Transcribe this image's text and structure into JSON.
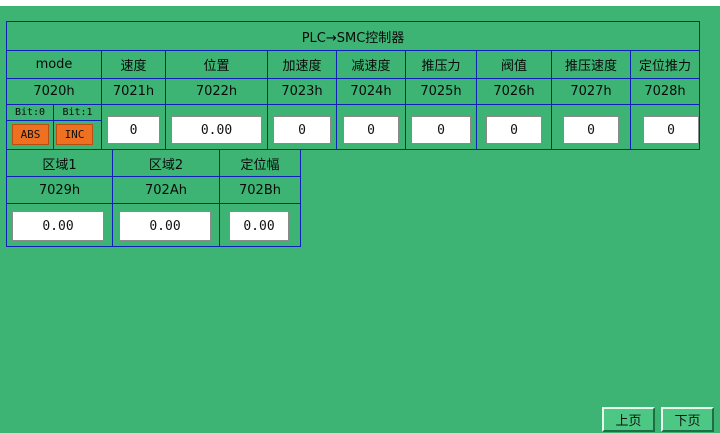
{
  "title": "PLC→SMC控制器",
  "row1": {
    "labels": [
      "mode",
      "速度",
      "位置",
      "加速度",
      "减速度",
      "推压力",
      "阀值",
      "推压速度",
      "定位推力"
    ],
    "addresses": [
      "7020h",
      "7021h",
      "7022h",
      "7023h",
      "7024h",
      "7025h",
      "7026h",
      "7027h",
      "7028h"
    ],
    "values": [
      "0",
      "0.00",
      "0",
      "0",
      "0",
      "0",
      "0",
      "0"
    ]
  },
  "mode": {
    "bit0_label": "Bit:0",
    "bit1_label": "Bit:1",
    "abs_label": "ABS",
    "inc_label": "INC"
  },
  "row2": {
    "labels": [
      "区域1",
      "区域2",
      "定位幅"
    ],
    "addresses": [
      "7029h",
      "702Ah",
      "702Bh"
    ],
    "values": [
      "0.00",
      "0.00",
      "0.00"
    ]
  },
  "nav": {
    "prev_label": "上页",
    "next_label": "下页"
  },
  "colors": {
    "background": "#3db374",
    "border": "#1020b8",
    "mode_button": "#f07022"
  }
}
